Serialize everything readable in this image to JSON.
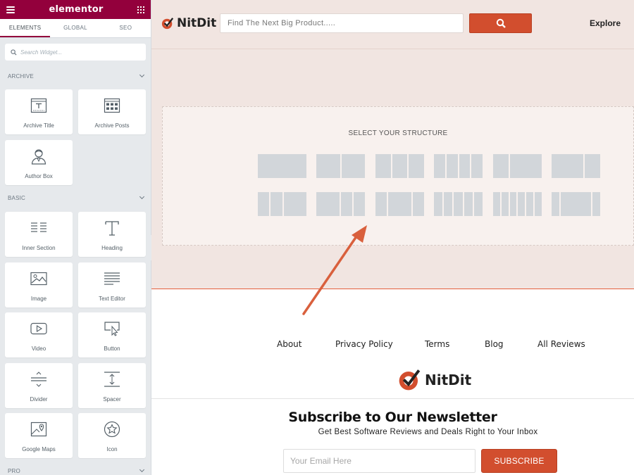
{
  "panel": {
    "brand": "elementor",
    "tabs": [
      {
        "label": "ELEMENTS"
      },
      {
        "label": "GLOBAL"
      },
      {
        "label": "SEO"
      }
    ],
    "search_placeholder": "Search Widget...",
    "categories": {
      "archive": "ARCHIVE",
      "basic": "BASIC",
      "pro": "PRO"
    },
    "widgets": {
      "archive_title": "Archive Title",
      "archive_posts": "Archive Posts",
      "author_box": "Author Box",
      "inner_section": "Inner Section",
      "heading": "Heading",
      "image": "Image",
      "text_editor": "Text Editor",
      "video": "Video",
      "button": "Button",
      "divider": "Divider",
      "spacer": "Spacer",
      "google_maps": "Google Maps",
      "icon": "Icon"
    },
    "accent_color": "#93003c"
  },
  "site": {
    "logo_text": "NitDit",
    "search_placeholder": "Find The Next Big Product.....",
    "explore_label": "Explore",
    "accent_color": "#d24e2e",
    "structure_title": "SELECT YOUR STRUCTURE",
    "footer_nav": [
      "About",
      "Privacy Policy",
      "Terms",
      "Blog",
      "All Reviews"
    ],
    "newsletter": {
      "title": "Subscribe to Our Newsletter",
      "subtitle": "Get Best Software Reviews and Deals Right to Your Inbox",
      "email_placeholder": "Your Email Here",
      "button_label": "SUBSCRIBE"
    }
  }
}
